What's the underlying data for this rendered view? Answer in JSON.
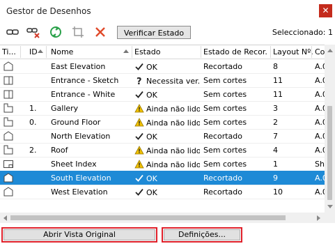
{
  "window": {
    "title": "Gestor de Desenhos",
    "close_glyph": "✕"
  },
  "toolbar": {
    "icons": [
      "link-drawings-icon",
      "unlink-drawings-icon",
      "update-refresh-icon",
      "crop-frame-icon",
      "delete-x-icon"
    ],
    "verify_label": "Verificar Estado",
    "selected_label": "Seleccionado: 1"
  },
  "table": {
    "columns": [
      "Ti...",
      "ID",
      "Nome",
      "Estado",
      "Estado de Recor...",
      "Layout Nº.",
      "Co"
    ],
    "rows": [
      {
        "type": "elevation",
        "id": "",
        "name": "East Elevation",
        "status_icon": "check",
        "status": "OK",
        "cut": "Recortado",
        "layout": "8",
        "co": "A.0"
      },
      {
        "type": "section",
        "id": "",
        "name": "Entrance - Sketch",
        "status_icon": "question",
        "status": "Necessita ver...",
        "cut": "Sem cortes",
        "layout": "11",
        "co": "A.0"
      },
      {
        "type": "section",
        "id": "",
        "name": "Entrance - White",
        "status_icon": "check",
        "status": "OK",
        "cut": "Sem cortes",
        "layout": "11",
        "co": "A.0"
      },
      {
        "type": "floorplan",
        "id": "1.",
        "name": "Gallery",
        "status_icon": "warning",
        "status": "Ainda não lido",
        "cut": "Sem cortes",
        "layout": "3",
        "co": "A.0"
      },
      {
        "type": "floorplan",
        "id": "0.",
        "name": "Ground Floor",
        "status_icon": "warning",
        "status": "Ainda não lido",
        "cut": "Sem cortes",
        "layout": "2",
        "co": "A.0"
      },
      {
        "type": "elevation",
        "id": "",
        "name": "North Elevation",
        "status_icon": "check",
        "status": "OK",
        "cut": "Recortado",
        "layout": "7",
        "co": "A.0"
      },
      {
        "type": "floorplan",
        "id": "2.",
        "name": "Roof",
        "status_icon": "warning",
        "status": "Ainda não lido",
        "cut": "Sem cortes",
        "layout": "4",
        "co": "A.0"
      },
      {
        "type": "sheet",
        "id": "",
        "name": "Sheet Index",
        "status_icon": "warning",
        "status": "Ainda não lido",
        "cut": "Sem cortes",
        "layout": "1",
        "co": "Sh"
      },
      {
        "type": "elevation",
        "id": "",
        "name": "South Elevation",
        "status_icon": "check",
        "status": "OK",
        "cut": "Recortado",
        "layout": "9",
        "co": "A.0",
        "selected": true
      },
      {
        "type": "elevation",
        "id": "",
        "name": "West Elevation",
        "status_icon": "check",
        "status": "OK",
        "cut": "Recortado",
        "layout": "10",
        "co": "A.0"
      }
    ]
  },
  "buttons": {
    "open_original": "Abrir Vista Original",
    "settings": "Definições..."
  },
  "colors": {
    "selection": "#1e8ad6",
    "highlight_border": "#e0202a",
    "warning": "#f2c200",
    "close": "#c42b1c"
  }
}
